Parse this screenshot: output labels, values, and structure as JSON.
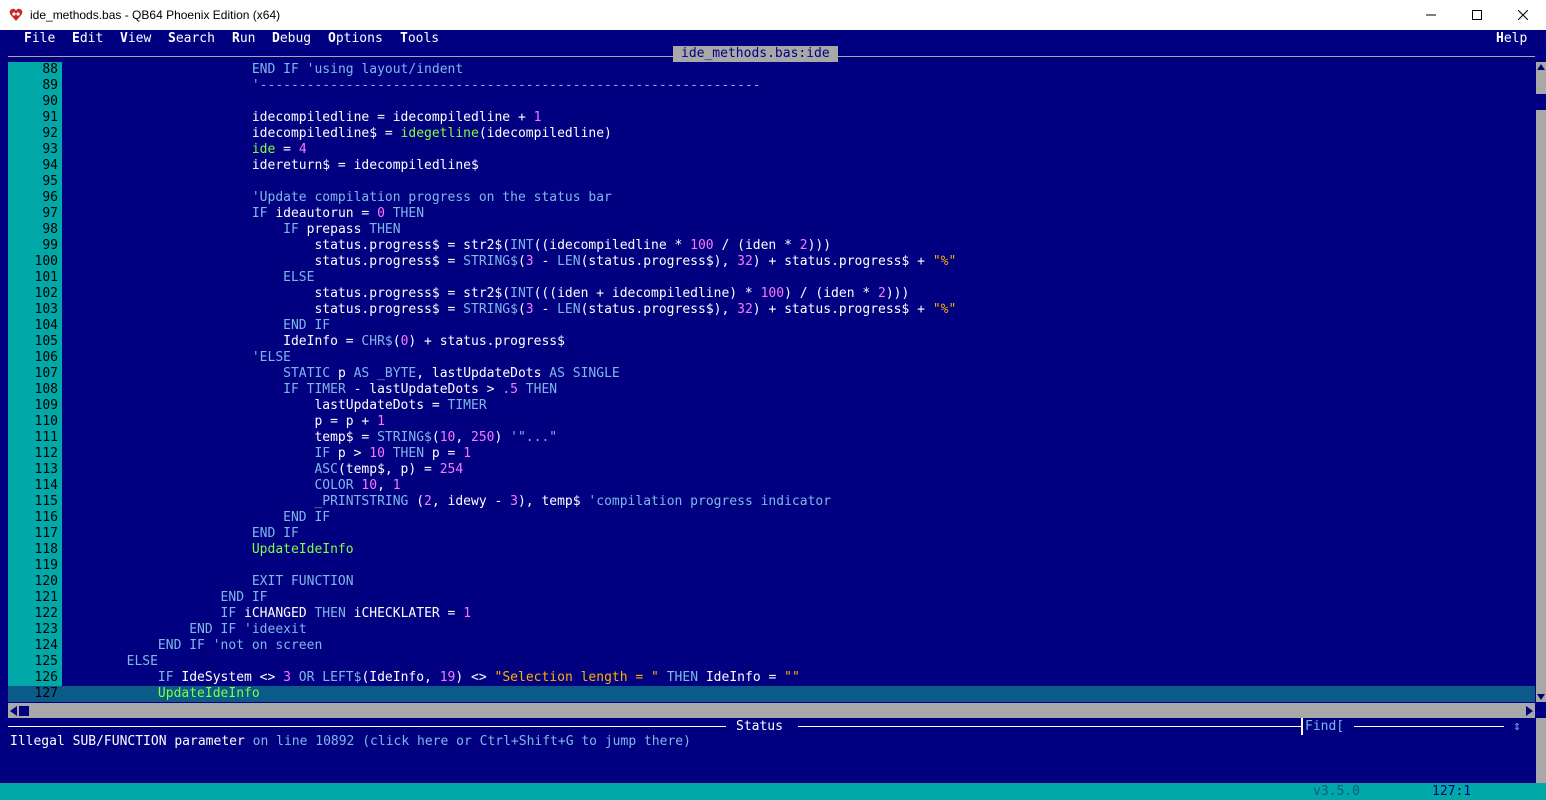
{
  "window": {
    "title": "ide_methods.bas - QB64 Phoenix Edition (x64)"
  },
  "menu": {
    "file": {
      "hk": "F",
      "rest": "ile"
    },
    "edit": {
      "hk": "E",
      "rest": "dit"
    },
    "view": {
      "hk": "V",
      "rest": "iew"
    },
    "search": {
      "hk": "S",
      "rest": "earch"
    },
    "run": {
      "hk": "R",
      "rest": "un"
    },
    "debug": {
      "hk": "D",
      "rest": "ebug"
    },
    "options": {
      "hk": "O",
      "rest": "ptions"
    },
    "tools": {
      "hk": "T",
      "rest": "ools"
    },
    "help": {
      "hk": "H",
      "rest": "elp"
    }
  },
  "editor": {
    "tab_label": "ide_methods.bas:ide",
    "lines": [
      {
        "n": "88",
        "t": [
          [
            "",
            "                        "
          ],
          [
            "kw",
            "END IF"
          ],
          [
            "cm",
            " 'using layout/indent"
          ]
        ]
      },
      {
        "n": "89",
        "t": [
          [
            "",
            "                        "
          ],
          [
            "cm",
            "'----------------------------------------------------------------"
          ]
        ]
      },
      {
        "n": "90",
        "t": [
          [
            "",
            ""
          ]
        ]
      },
      {
        "n": "91",
        "t": [
          [
            "",
            "                        idecompiledline = idecompiledline + "
          ],
          [
            "num",
            "1"
          ]
        ]
      },
      {
        "n": "92",
        "t": [
          [
            "",
            "                        idecompiledline$ = "
          ],
          [
            "fn",
            "idegetline"
          ],
          [
            "",
            "(idecompiledline)"
          ]
        ]
      },
      {
        "n": "93",
        "t": [
          [
            "",
            "                        "
          ],
          [
            "fn",
            "ide"
          ],
          [
            "",
            " = "
          ],
          [
            "num",
            "4"
          ]
        ]
      },
      {
        "n": "94",
        "t": [
          [
            "",
            "                        idereturn$ = idecompiledline$"
          ]
        ]
      },
      {
        "n": "95",
        "t": [
          [
            "",
            ""
          ]
        ]
      },
      {
        "n": "96",
        "t": [
          [
            "",
            "                        "
          ],
          [
            "cm",
            "'Update compilation progress on the status bar"
          ]
        ]
      },
      {
        "n": "97",
        "t": [
          [
            "",
            "                        "
          ],
          [
            "kw",
            "IF"
          ],
          [
            "",
            " ideautorun = "
          ],
          [
            "num",
            "0"
          ],
          [
            "kw",
            " THEN"
          ]
        ]
      },
      {
        "n": "98",
        "t": [
          [
            "",
            "                            "
          ],
          [
            "kw",
            "IF"
          ],
          [
            "",
            " prepass "
          ],
          [
            "kw",
            "THEN"
          ]
        ]
      },
      {
        "n": "99",
        "t": [
          [
            "",
            "                                status.progress$ = str2$("
          ],
          [
            "kw",
            "INT"
          ],
          [
            "",
            "((idecompiledline * "
          ],
          [
            "num",
            "100"
          ],
          [
            "",
            " / (iden * "
          ],
          [
            "num",
            "2"
          ],
          [
            "",
            ")))"
          ]
        ]
      },
      {
        "n": "100",
        "t": [
          [
            "",
            "                                status.progress$ = "
          ],
          [
            "kw",
            "STRING$"
          ],
          [
            "",
            "("
          ],
          [
            "num",
            "3"
          ],
          [
            "",
            " - "
          ],
          [
            "kw",
            "LEN"
          ],
          [
            "",
            "(status.progress$), "
          ],
          [
            "num",
            "32"
          ],
          [
            "",
            ") + status.progress$ + "
          ],
          [
            "str",
            "\"%\""
          ]
        ]
      },
      {
        "n": "101",
        "t": [
          [
            "",
            "                            "
          ],
          [
            "kw",
            "ELSE"
          ]
        ]
      },
      {
        "n": "102",
        "t": [
          [
            "",
            "                                status.progress$ = str2$("
          ],
          [
            "kw",
            "INT"
          ],
          [
            "",
            "(((iden + idecompiledline) * "
          ],
          [
            "num",
            "100"
          ],
          [
            "",
            ") / (iden * "
          ],
          [
            "num",
            "2"
          ],
          [
            "",
            ")))"
          ]
        ]
      },
      {
        "n": "103",
        "t": [
          [
            "",
            "                                status.progress$ = "
          ],
          [
            "kw",
            "STRING$"
          ],
          [
            "",
            "("
          ],
          [
            "num",
            "3"
          ],
          [
            "",
            " - "
          ],
          [
            "kw",
            "LEN"
          ],
          [
            "",
            "(status.progress$), "
          ],
          [
            "num",
            "32"
          ],
          [
            "",
            ") + status.progress$ + "
          ],
          [
            "str",
            "\"%\""
          ]
        ]
      },
      {
        "n": "104",
        "t": [
          [
            "",
            "                            "
          ],
          [
            "kw",
            "END IF"
          ]
        ]
      },
      {
        "n": "105",
        "t": [
          [
            "",
            "                            IdeInfo = "
          ],
          [
            "kw",
            "CHR$"
          ],
          [
            "",
            "("
          ],
          [
            "num",
            "0"
          ],
          [
            "",
            ") + status.progress$"
          ]
        ]
      },
      {
        "n": "106",
        "t": [
          [
            "",
            "                        "
          ],
          [
            "cm",
            "'ELSE"
          ]
        ]
      },
      {
        "n": "107",
        "t": [
          [
            "",
            "                            "
          ],
          [
            "kw",
            "STATIC"
          ],
          [
            "",
            " p "
          ],
          [
            "kw",
            "AS _BYTE"
          ],
          [
            "",
            ", lastUpdateDots "
          ],
          [
            "kw",
            "AS SINGLE"
          ]
        ]
      },
      {
        "n": "108",
        "t": [
          [
            "",
            "                            "
          ],
          [
            "kw",
            "IF TIMER"
          ],
          [
            "",
            " - lastUpdateDots > "
          ],
          [
            "num",
            ".5"
          ],
          [
            "kw",
            " THEN"
          ]
        ]
      },
      {
        "n": "109",
        "t": [
          [
            "",
            "                                lastUpdateDots = "
          ],
          [
            "kw",
            "TIMER"
          ]
        ]
      },
      {
        "n": "110",
        "t": [
          [
            "",
            "                                p = p + "
          ],
          [
            "num",
            "1"
          ]
        ]
      },
      {
        "n": "111",
        "t": [
          [
            "",
            "                                temp$ = "
          ],
          [
            "kw",
            "STRING$"
          ],
          [
            "",
            "("
          ],
          [
            "num",
            "10"
          ],
          [
            "",
            ", "
          ],
          [
            "num",
            "250"
          ],
          [
            "",
            ") "
          ],
          [
            "cm",
            "'\"...\""
          ]
        ]
      },
      {
        "n": "112",
        "t": [
          [
            "",
            "                                "
          ],
          [
            "kw",
            "IF"
          ],
          [
            "",
            " p > "
          ],
          [
            "num",
            "10"
          ],
          [
            "kw",
            " THEN"
          ],
          [
            "",
            " p = "
          ],
          [
            "num",
            "1"
          ]
        ]
      },
      {
        "n": "113",
        "t": [
          [
            "",
            "                                "
          ],
          [
            "kw",
            "ASC"
          ],
          [
            "",
            "(temp$, p) = "
          ],
          [
            "num",
            "254"
          ]
        ]
      },
      {
        "n": "114",
        "t": [
          [
            "",
            "                                "
          ],
          [
            "kw",
            "COLOR"
          ],
          [
            "",
            ""
          ],
          [
            "num",
            " 10"
          ],
          [
            "",
            ", "
          ],
          [
            "num",
            "1"
          ]
        ]
      },
      {
        "n": "115",
        "t": [
          [
            "",
            "                                "
          ],
          [
            "kw",
            "_PRINTSTRING"
          ],
          [
            "",
            " ("
          ],
          [
            "num",
            "2"
          ],
          [
            "",
            ", idewy - "
          ],
          [
            "num",
            "3"
          ],
          [
            "",
            "), temp$ "
          ],
          [
            "cm",
            "'compilation progress indicator"
          ]
        ]
      },
      {
        "n": "116",
        "t": [
          [
            "",
            "                            "
          ],
          [
            "kw",
            "END IF"
          ]
        ]
      },
      {
        "n": "117",
        "t": [
          [
            "",
            "                        "
          ],
          [
            "kw",
            "END IF"
          ]
        ]
      },
      {
        "n": "118",
        "t": [
          [
            "",
            "                        "
          ],
          [
            "fn",
            "UpdateIdeInfo"
          ]
        ]
      },
      {
        "n": "119",
        "t": [
          [
            "",
            ""
          ]
        ]
      },
      {
        "n": "120",
        "t": [
          [
            "",
            "                        "
          ],
          [
            "kw",
            "EXIT FUNCTION"
          ]
        ]
      },
      {
        "n": "121",
        "t": [
          [
            "",
            "                    "
          ],
          [
            "kw",
            "END IF"
          ]
        ]
      },
      {
        "n": "122",
        "t": [
          [
            "",
            "                    "
          ],
          [
            "kw",
            "IF"
          ],
          [
            "",
            " iCHANGED "
          ],
          [
            "kw",
            "THEN"
          ],
          [
            "",
            " iCHECKLATER = "
          ],
          [
            "num",
            "1"
          ]
        ]
      },
      {
        "n": "123",
        "t": [
          [
            "",
            "                "
          ],
          [
            "kw",
            "END IF"
          ],
          [
            "cm",
            " 'ideexit"
          ]
        ]
      },
      {
        "n": "124",
        "t": [
          [
            "",
            "            "
          ],
          [
            "kw",
            "END IF"
          ],
          [
            "cm",
            " 'not on screen"
          ]
        ]
      },
      {
        "n": "125",
        "t": [
          [
            "",
            "        "
          ],
          [
            "kw",
            "ELSE"
          ]
        ]
      },
      {
        "n": "126",
        "t": [
          [
            "",
            "            "
          ],
          [
            "kw",
            "IF"
          ],
          [
            "",
            " IdeSystem <> "
          ],
          [
            "num",
            "3"
          ],
          [
            "kw",
            " OR LEFT$"
          ],
          [
            "",
            "(IdeInfo, "
          ],
          [
            "num",
            "19"
          ],
          [
            "",
            ") <> "
          ],
          [
            "str",
            "\"Selection length = \""
          ],
          [
            "kw",
            " THEN"
          ],
          [
            "",
            " IdeInfo = "
          ],
          [
            "str",
            "\"\""
          ]
        ]
      },
      {
        "n": "127",
        "t": [
          [
            "",
            "            "
          ],
          [
            "fn",
            "UpdateIdeInfo"
          ]
        ]
      }
    ]
  },
  "status": {
    "header": "Status",
    "find_label": "Find[",
    "message_plain": "Illegal SUB/FUNCTION parameter ",
    "message_link": "on line 10892 (click here or Ctrl+Shift+G to jump there)"
  },
  "bottom": {
    "version": "v3.5.0",
    "position": "127:1"
  }
}
